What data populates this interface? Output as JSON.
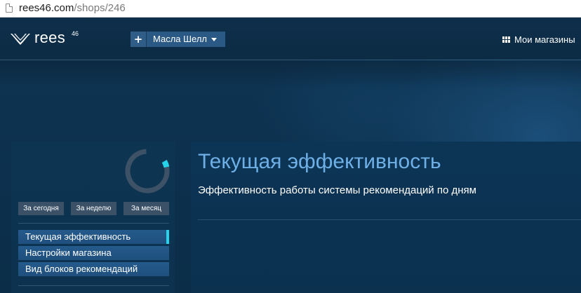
{
  "browser": {
    "url_host": "rees46.com",
    "url_path": "/shops/246"
  },
  "header": {
    "logo_text": "rees",
    "logo_sup": "46",
    "add_button": "+",
    "shop_selector": "Масла Шелл",
    "my_shops_label": "Мои магазины"
  },
  "sidebar": {
    "range_buttons": [
      "За сегодня",
      "За неделю",
      "За месяц"
    ],
    "menu_items": [
      {
        "label": "Текущая эффективность",
        "active": true
      },
      {
        "label": "Настройки магазина",
        "active": false
      },
      {
        "label": "Вид блоков рекомендаций",
        "active": false
      }
    ]
  },
  "main": {
    "title": "Текущая эффективность",
    "subtitle": "Эффективность работы системы рекомендаций по дням"
  },
  "colors": {
    "accent": "#27d3ea",
    "title": "#6eb0e6",
    "menu_item": "#245a8c",
    "background": "#0c3049"
  }
}
